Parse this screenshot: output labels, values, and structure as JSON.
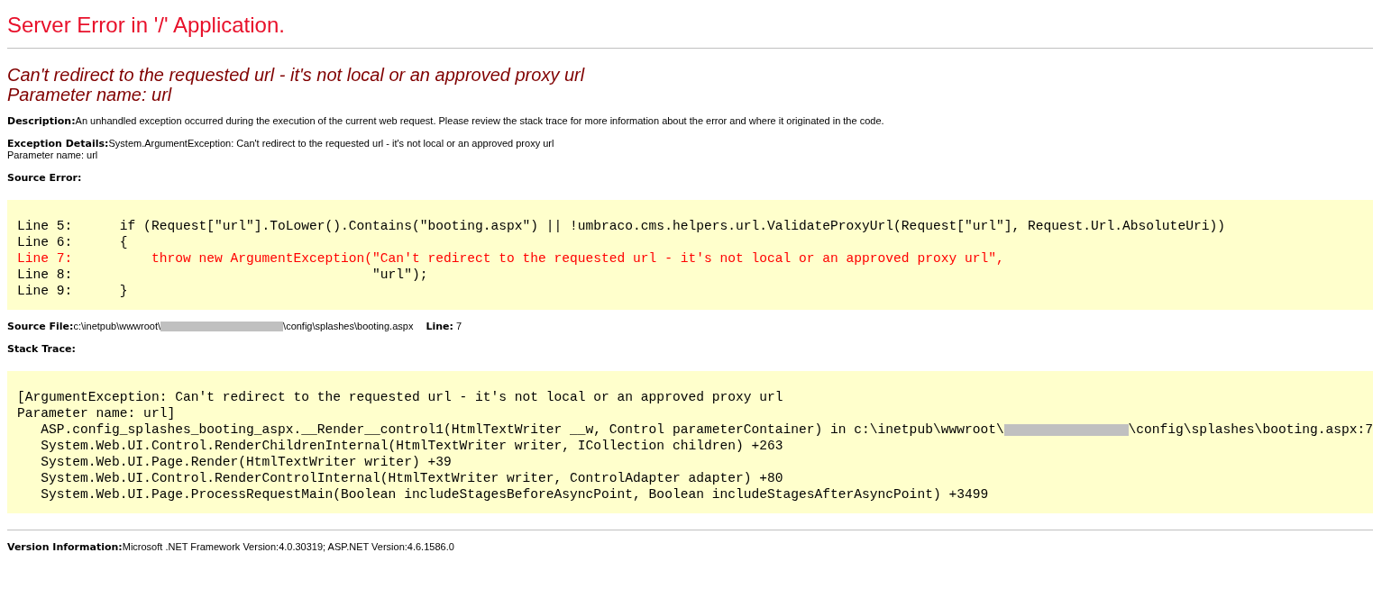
{
  "title": "Server Error in '/' Application.",
  "error_heading": [
    "Can't redirect to the requested url - it's not local or an approved proxy url",
    "Parameter name: url"
  ],
  "description": {
    "label": "Description:",
    "text": "An unhandled exception occurred during the execution of the current web request. Please review the stack trace for more information about the error and where it originated in the code."
  },
  "exception_details": {
    "label": "Exception Details:",
    "text": "System.ArgumentException: Can't redirect to the requested url - it's not local or an approved proxy url",
    "text_line_2": "Parameter name: url"
  },
  "source_error": {
    "label": "Source Error:",
    "lines": [
      {
        "text": "Line 5:      if (Request[\"url\"].ToLower().Contains(\"booting.aspx\") || !umbraco.cms.helpers.url.ValidateProxyUrl(Request[\"url\"], Request.Url.AbsoluteUri))",
        "highlighted": false
      },
      {
        "text": "Line 6:      {",
        "highlighted": false
      },
      {
        "text": "Line 7:          throw new ArgumentException(\"Can't redirect to the requested url - it's not local or an approved proxy url\",",
        "highlighted": true
      },
      {
        "text": "Line 8:                                      \"url\");",
        "highlighted": false
      },
      {
        "text": "Line 9:      }",
        "highlighted": false
      }
    ]
  },
  "source_file": {
    "label": "Source File:",
    "path_start": "c:\\inetpub\\wwwroot\\",
    "path_end": "\\config\\splashes\\booting.aspx",
    "line_label": "Line:",
    "line_value": "7"
  },
  "stack_trace": {
    "label": "Stack Trace:",
    "lines": [
      {
        "text": "[ArgumentException: Can't redirect to the requested url - it's not local or an approved proxy url"
      },
      {
        "text": "Parameter name: url]"
      },
      {
        "text": "   ASP.config_splashes_booting_aspx.__Render__control1(HtmlTextWriter __w, Control parameterContainer) in c:\\inetpub\\wwwroot\\",
        "text_after": "\\config\\splashes\\booting.aspx:7"
      },
      {
        "text": "   System.Web.UI.Control.RenderChildrenInternal(HtmlTextWriter writer, ICollection children) +263"
      },
      {
        "text": "   System.Web.UI.Page.Render(HtmlTextWriter writer) +39"
      },
      {
        "text": "   System.Web.UI.Control.RenderControlInternal(HtmlTextWriter writer, ControlAdapter adapter) +80"
      },
      {
        "text": "   System.Web.UI.Page.ProcessRequestMain(Boolean includeStagesBeforeAsyncPoint, Boolean includeStagesAfterAsyncPoint) +3499"
      }
    ]
  },
  "version_information": {
    "label": "Version Information:",
    "text": "Microsoft .NET Framework Version:4.0.30319; ASP.NET Version:4.6.1586.0"
  }
}
